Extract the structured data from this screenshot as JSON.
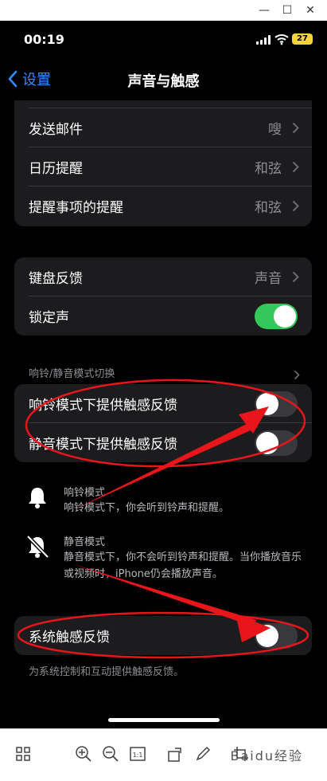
{
  "status_bar": {
    "time": "00:19",
    "battery": "27"
  },
  "nav": {
    "back_label": "设置",
    "title": "声音与触感"
  },
  "alerts_group": [
    {
      "label": "发送邮件",
      "value": "嗖"
    },
    {
      "label": "日历提醒",
      "value": "和弦"
    },
    {
      "label": "提醒事项的提醒",
      "value": "和弦"
    }
  ],
  "keyboard_group": {
    "keyboard_feedback": {
      "label": "键盘反馈",
      "value": "声音"
    },
    "lock_sound": {
      "label": "锁定声",
      "on": true
    }
  },
  "ring_silent": {
    "header": "响铃/静音模式切换",
    "ring_haptics": {
      "label": "响铃模式下提供触感反馈",
      "on": false
    },
    "silent_haptics": {
      "label": "静音模式下提供触感反馈",
      "on": false
    },
    "ring_info": {
      "title": "响铃模式",
      "desc": "响铃模式下，你会听到铃声和提醒。"
    },
    "silent_info": {
      "title": "静音模式",
      "desc": "静音模式下，你不会听到铃声和提醒。当你播放音乐或视频时，iPhone仍会播放声音。"
    }
  },
  "system_haptics": {
    "label": "系统触感反馈",
    "on": false,
    "footer": "为系统控制和互动提供触感反馈。"
  },
  "colors": {
    "accent": "#2f8cff",
    "toggle_on": "#34c759",
    "annotation": "#e8151b",
    "cell": "#1c1c1e"
  },
  "watermark": "Baidu经验"
}
